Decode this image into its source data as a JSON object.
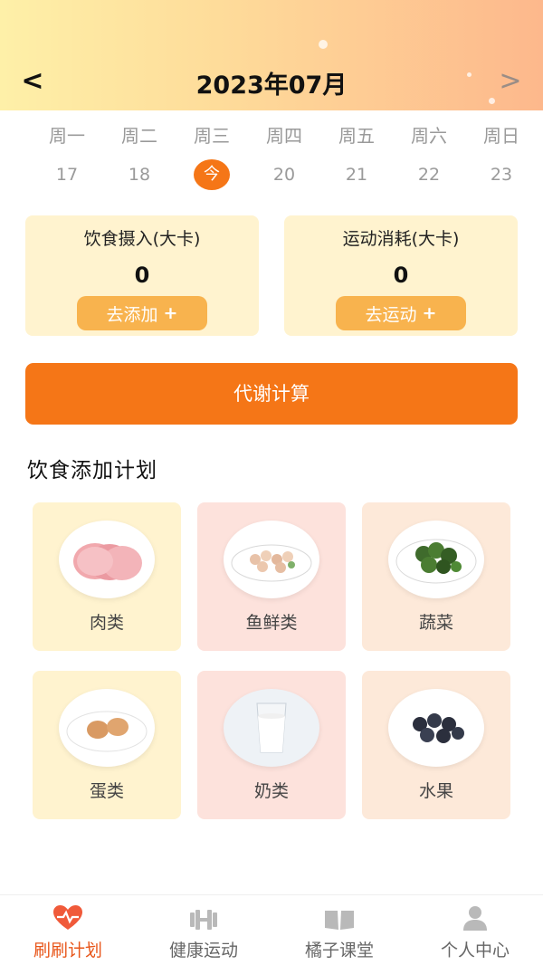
{
  "header": {
    "month_title": "2023年07月",
    "prev_icon": "<",
    "next_icon": ">"
  },
  "calendar": {
    "weekdays": [
      "周一",
      "周二",
      "周三",
      "周四",
      "周五",
      "周六",
      "周日"
    ],
    "dates": [
      "17",
      "18",
      "今",
      "20",
      "21",
      "22",
      "23"
    ]
  },
  "intake": {
    "title": "饮食摄入(大卡)",
    "value": "0",
    "button_label": "去添加",
    "button_plus": "+"
  },
  "burn": {
    "title": "运动消耗(大卡)",
    "value": "0",
    "button_label": "去运动",
    "button_plus": "+"
  },
  "metabolism": {
    "label": "代谢计算"
  },
  "plan": {
    "title": "饮食添加计划",
    "categories": [
      {
        "label": "肉类",
        "icon": "meat-icon"
      },
      {
        "label": "鱼鲜类",
        "icon": "seafood-icon"
      },
      {
        "label": "蔬菜",
        "icon": "vegetable-icon"
      },
      {
        "label": "蛋类",
        "icon": "egg-icon"
      },
      {
        "label": "奶类",
        "icon": "milk-icon"
      },
      {
        "label": "水果",
        "icon": "fruit-icon"
      }
    ]
  },
  "tabs": [
    {
      "label": "刷刷计划",
      "icon": "heart-icon"
    },
    {
      "label": "健康运动",
      "icon": "dumbbell-icon"
    },
    {
      "label": "橘子课堂",
      "icon": "book-icon"
    },
    {
      "label": "个人中心",
      "icon": "person-icon"
    }
  ],
  "colors": {
    "accent": "#f57617",
    "button_light": "#f8b34e",
    "card_yellow": "#fff3cf",
    "card_pink": "#fde2dc",
    "card_peach": "#fde9d9",
    "active_tab": "#e8561a"
  }
}
